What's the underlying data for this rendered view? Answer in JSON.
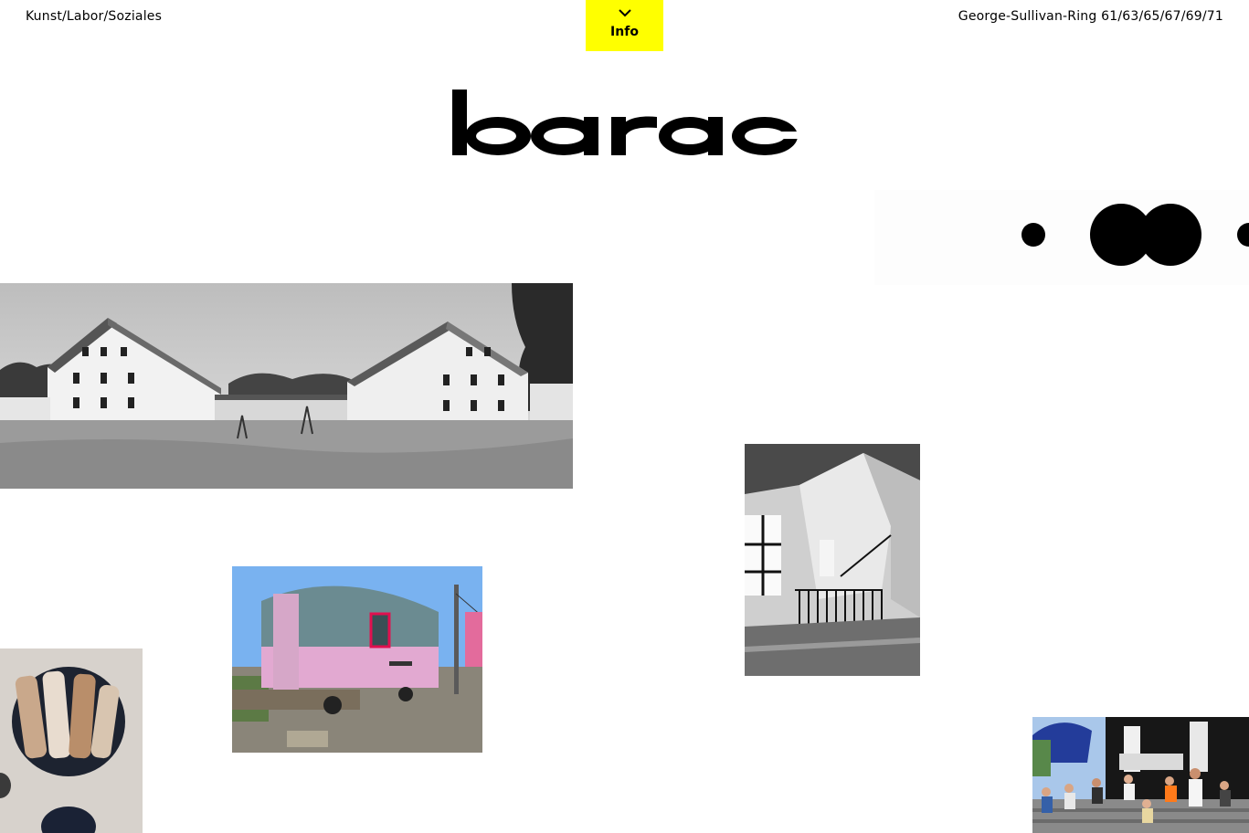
{
  "header": {
    "tagline": "Kunst/Labor/Soziales",
    "address": "George-Sullivan-Ring 61/63/65/67/69/71",
    "info_label": "Info",
    "info_color": "#ffff00"
  },
  "logo": {
    "text": "barac"
  },
  "decor": {
    "icon": "dots-decoration"
  },
  "photos": [
    {
      "subject": "barracks-buildings",
      "style": "black-and-white"
    },
    {
      "subject": "staircase-interior",
      "style": "black-and-white"
    },
    {
      "subject": "construction-trailer",
      "style": "color"
    },
    {
      "subject": "food-plate",
      "style": "color"
    },
    {
      "subject": "crowd-gathering",
      "style": "color"
    }
  ]
}
